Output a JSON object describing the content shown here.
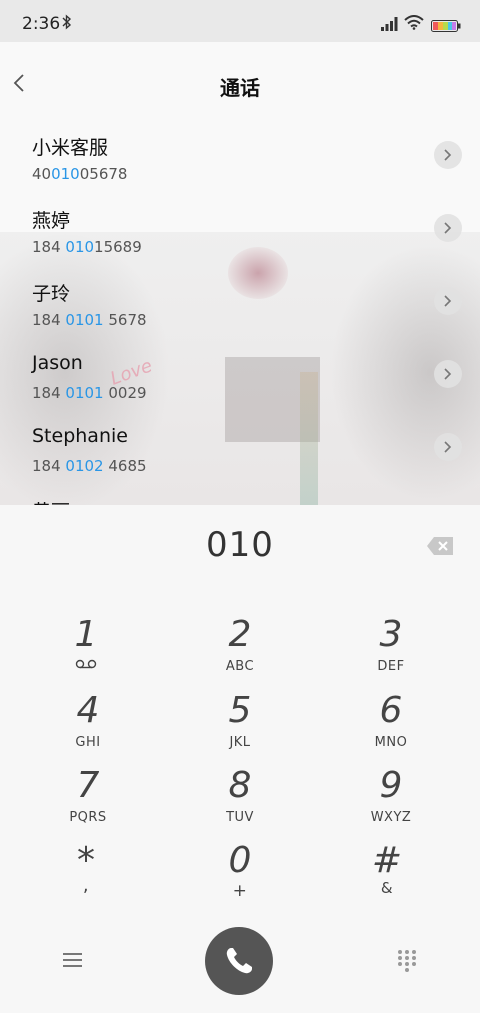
{
  "status_bar": {
    "time": "2:36"
  },
  "header": {
    "title": "通话"
  },
  "contacts": [
    {
      "name": "小米客服",
      "num_pre": "40",
      "num_hl": "010",
      "num_post": "05678"
    },
    {
      "name": "燕婷",
      "num_pre": "184 ",
      "num_hl": "010",
      "num_post": "15689"
    },
    {
      "name": "子玲",
      "num_pre": "184 ",
      "num_hl": "0101",
      "num_post": " 5678"
    },
    {
      "name": "Jason",
      "num_pre": "184 ",
      "num_hl": "0101",
      "num_post": " 0029"
    },
    {
      "name": "Stephanie",
      "num_pre": "184 ",
      "num_hl": "0102",
      "num_post": " 4685"
    },
    {
      "name": "黄丽"
    }
  ],
  "background_text": "Love",
  "dialer": {
    "display": "010",
    "keys": [
      {
        "digit": "1",
        "letters": ""
      },
      {
        "digit": "2",
        "letters": "ABC"
      },
      {
        "digit": "3",
        "letters": "DEF"
      },
      {
        "digit": "4",
        "letters": "GHI"
      },
      {
        "digit": "5",
        "letters": "JKL"
      },
      {
        "digit": "6",
        "letters": "MNO"
      },
      {
        "digit": "7",
        "letters": "PQRS"
      },
      {
        "digit": "8",
        "letters": "TUV"
      },
      {
        "digit": "9",
        "letters": "WXYZ"
      },
      {
        "digit": "*",
        "letters": ","
      },
      {
        "digit": "0",
        "letters": "+"
      },
      {
        "digit": "#",
        "letters": "&"
      }
    ]
  },
  "colors": {
    "highlight": "#2a96e6",
    "call_button": "#555555"
  },
  "icons": [
    "bluetooth-icon",
    "signal-icon",
    "wifi-icon",
    "battery-icon",
    "back-chevron-icon",
    "chevron-right-icon",
    "backspace-icon",
    "voicemail-icon",
    "menu-icon",
    "phone-icon",
    "keypad-icon"
  ]
}
